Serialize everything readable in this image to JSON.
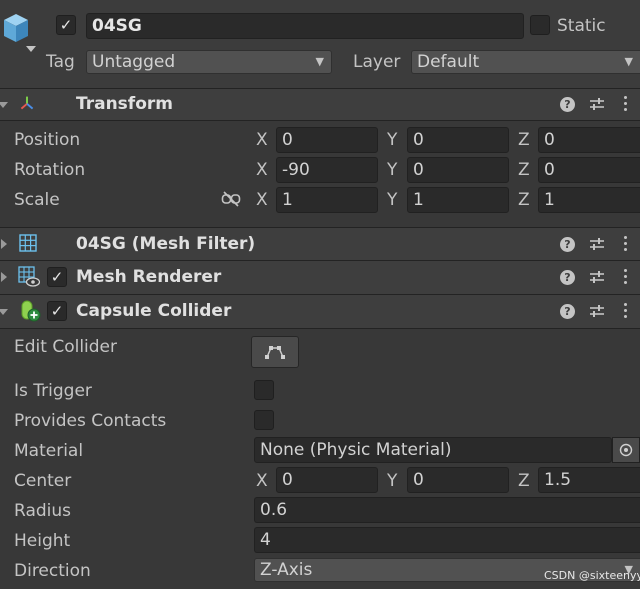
{
  "object": {
    "name": "04SG",
    "active": true,
    "static_label": "Static",
    "static_checked": false,
    "tag_label": "Tag",
    "tag_value": "Untagged",
    "layer_label": "Layer",
    "layer_value": "Default"
  },
  "icons": {
    "help": "?",
    "check": "✓",
    "dropdown_arrow": "▼"
  },
  "transform": {
    "title": "Transform",
    "position": {
      "label": "Position",
      "x": "0",
      "y": "0",
      "z": "0"
    },
    "rotation": {
      "label": "Rotation",
      "x": "-90",
      "y": "0",
      "z": "0"
    },
    "scale": {
      "label": "Scale",
      "x": "1",
      "y": "1",
      "z": "1"
    }
  },
  "axes": {
    "x": "X",
    "y": "Y",
    "z": "Z"
  },
  "mesh_filter": {
    "title": "04SG (Mesh Filter)"
  },
  "mesh_renderer": {
    "title": "Mesh Renderer",
    "enabled": true
  },
  "capsule_collider": {
    "title": "Capsule Collider",
    "enabled": true,
    "edit_collider_label": "Edit Collider",
    "is_trigger_label": "Is Trigger",
    "is_trigger": false,
    "provides_contacts_label": "Provides Contacts",
    "provides_contacts": false,
    "material_label": "Material",
    "material_value": "None (Physic Material)",
    "center": {
      "label": "Center",
      "x": "0",
      "y": "0",
      "z": "1.5"
    },
    "radius_label": "Radius",
    "radius_value": "0.6",
    "height_label": "Height",
    "height_value": "4",
    "direction_label": "Direction",
    "direction_value": "Z-Axis"
  },
  "watermark": "CSDN @sixteenyy"
}
